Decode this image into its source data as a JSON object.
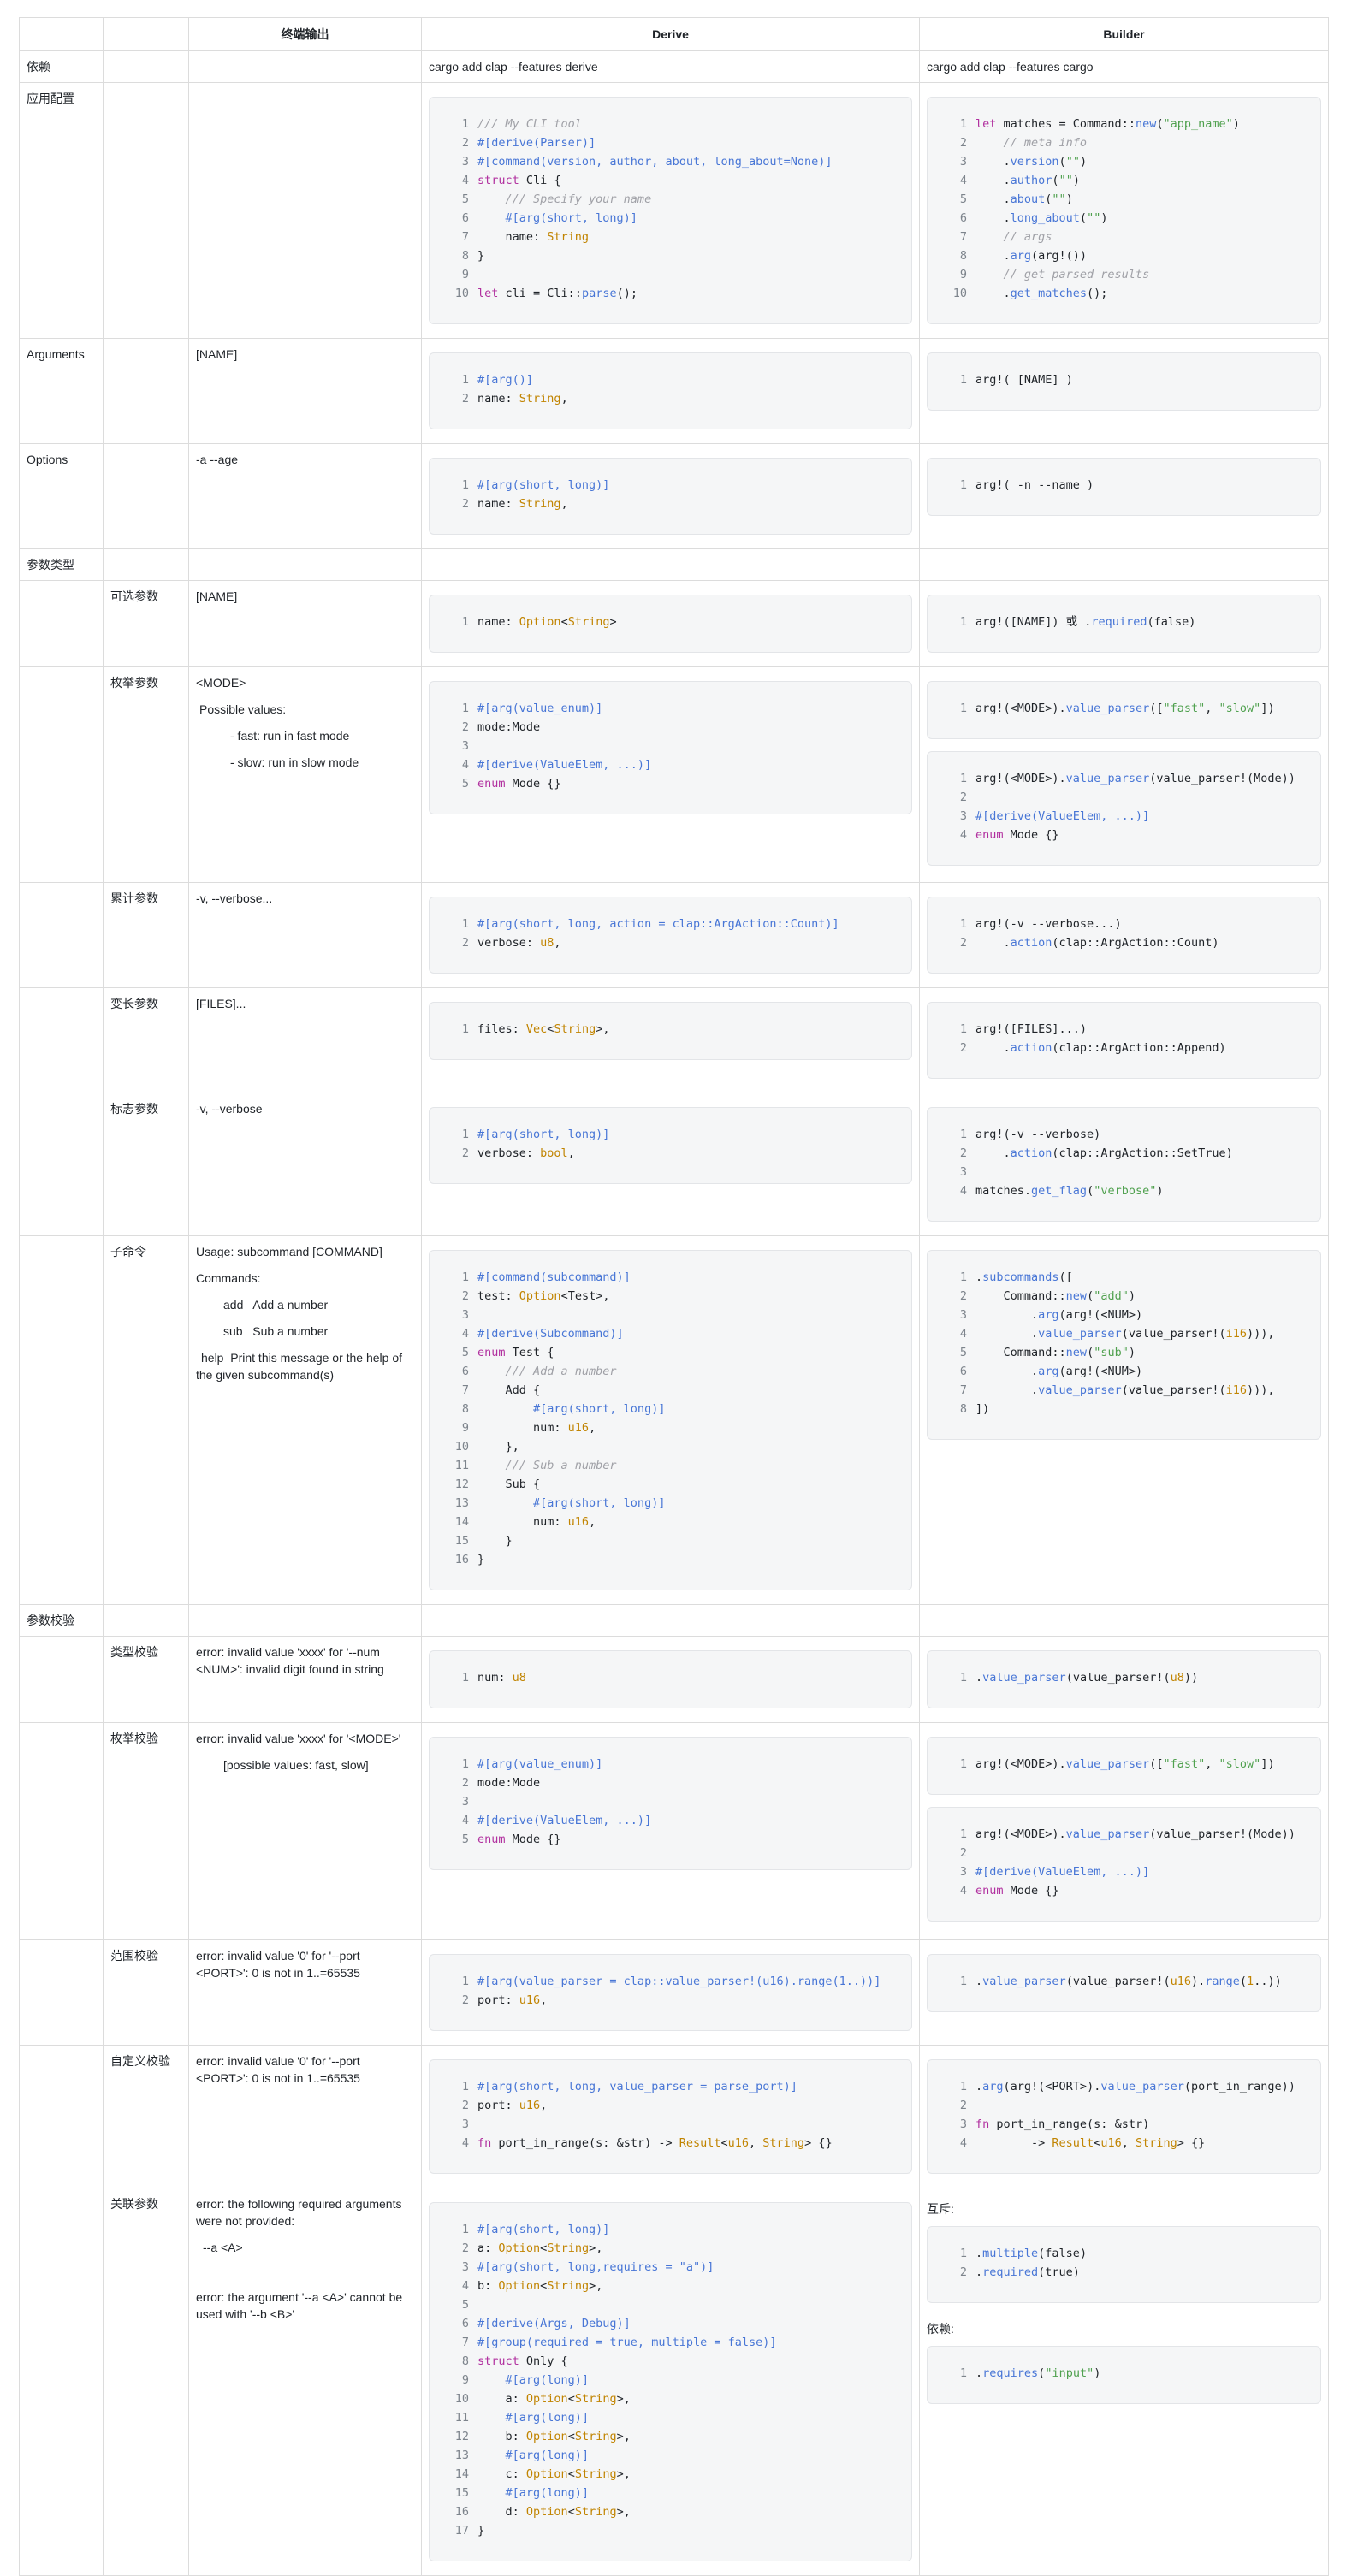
{
  "header": {
    "col1": "",
    "col2": "",
    "col3": "终端输出",
    "col4": "Derive",
    "col5": "Builder"
  },
  "rows": {
    "dep": {
      "cat": "依赖",
      "derive": "cargo add clap --features derive",
      "builder": "cargo add clap --features cargo"
    },
    "appconfig": {
      "cat": "应用配置"
    },
    "arguments": {
      "cat": "Arguments",
      "out": "[NAME]"
    },
    "options": {
      "cat": "Options",
      "out": "-a --age"
    },
    "argtypes": {
      "cat": "参数类型"
    },
    "optional": {
      "sub": "可选参数",
      "out": "[NAME]"
    },
    "enum": {
      "sub": "枚举参数",
      "out": [
        "<MODE>",
        "Possible values:",
        "- fast: run in fast mode",
        "- slow: run in slow mode"
      ]
    },
    "count": {
      "sub": "累计参数",
      "out": "-v, --verbose..."
    },
    "varargs": {
      "sub": "变长参数",
      "out": "[FILES]..."
    },
    "flag": {
      "sub": "标志参数",
      "out": "-v, --verbose"
    },
    "subcmd": {
      "sub": "子命令",
      "out": [
        "Usage: subcommand [COMMAND]",
        "Commands:",
        "add   Add a number",
        "sub   Sub a number",
        "help  Print this message or the help of the given subcommand(s)"
      ]
    },
    "validation": {
      "cat": "参数校验"
    },
    "typecheck": {
      "sub": "类型校验",
      "out": "error: invalid value 'xxxx' for '--num <NUM>': invalid digit found in string"
    },
    "enumcheck": {
      "sub": "枚举校验",
      "out": [
        "error: invalid value 'xxxx' for '<MODE>'",
        "[possible values: fast, slow]"
      ]
    },
    "rangecheck": {
      "sub": "范围校验",
      "out": "error: invalid value '0' for '--port <PORT>': 0 is not in 1..=65535"
    },
    "customcheck": {
      "sub": "自定义校验",
      "out": "error: invalid value '0' for '--port <PORT>': 0 is not in 1..=65535"
    },
    "relation": {
      "sub": "关联参数",
      "out": [
        "error: the following required arguments were not provided:",
        "--a <A>",
        "error: the argument '--a <A>' cannot be used with '--b <B>'"
      ],
      "mutex": "互斥:",
      "depends": "依赖:"
    }
  },
  "code": {
    "app_derive": [
      "/// My CLI tool",
      "#[derive(Parser)]",
      "#[command(version, author, about, long_about=None)]",
      "struct Cli {",
      "    /// Specify your name",
      "    #[arg(short, long)]",
      "    name: String",
      "}",
      "",
      "let cli = Cli::parse();"
    ],
    "app_builder": [
      "let matches = Command::new(\"app_name\")",
      "    // meta info",
      "    .version(\"\")",
      "    .author(\"\")",
      "    .about(\"\")",
      "    .long_about(\"\")",
      "    // args",
      "    .arg(arg!())",
      "    // get parsed results",
      "    .get_matches();"
    ],
    "args_derive": [
      "#[arg()]",
      "name: String,"
    ],
    "args_builder": [
      "arg!( [NAME] )"
    ],
    "opts_derive": [
      "#[arg(short, long)]",
      "name: String,"
    ],
    "opts_builder": [
      "arg!( -n --name )"
    ],
    "optional_derive": [
      "name: Option<String>"
    ],
    "optional_builder": [
      "arg!([NAME]) 或 .required(false)"
    ],
    "enum_derive": [
      "#[arg(value_enum)]",
      "mode:Mode",
      "",
      "#[derive(ValueElem, ...)]",
      "enum Mode {}"
    ],
    "enum_builder1": [
      "arg!(<MODE>).value_parser([\"fast\", \"slow\"])"
    ],
    "enum_builder2": [
      "arg!(<MODE>).value_parser(value_parser!(Mode))",
      "",
      "#[derive(ValueElem, ...)]",
      "enum Mode {}"
    ],
    "count_derive": [
      "#[arg(short, long, action = clap::ArgAction::Count)]",
      "verbose: u8,"
    ],
    "count_builder": [
      "arg!(-v --verbose...)",
      "    .action(clap::ArgAction::Count)"
    ],
    "var_derive": [
      "files: Vec<String>,"
    ],
    "var_builder": [
      "arg!([FILES]...)",
      "    .action(clap::ArgAction::Append)"
    ],
    "flag_derive": [
      "#[arg(short, long)]",
      "verbose: bool,"
    ],
    "flag_builder": [
      "arg!(-v --verbose)",
      "    .action(clap::ArgAction::SetTrue)",
      "",
      "matches.get_flag(\"verbose\")"
    ],
    "sub_derive": [
      "#[command(subcommand)]",
      "test: Option<Test>,",
      "",
      "#[derive(Subcommand)]",
      "enum Test {",
      "    /// Add a number",
      "    Add {",
      "        #[arg(short, long)]",
      "        num: u16,",
      "    },",
      "    /// Sub a number",
      "    Sub {",
      "        #[arg(short, long)]",
      "        num: u16,",
      "    }",
      "}"
    ],
    "sub_builder": [
      ".subcommands([",
      "    Command::new(\"add\")",
      "        .arg(arg!(<NUM>)",
      "        .value_parser(value_parser!(i16))),",
      "    Command::new(\"sub\")",
      "        .arg(arg!(<NUM>)",
      "        .value_parser(value_parser!(i16))),",
      "])"
    ],
    "type_derive": [
      "num: u8"
    ],
    "type_builder": [
      ".value_parser(value_parser!(u8))"
    ],
    "enumv_derive": [
      "#[arg(value_enum)]",
      "mode:Mode",
      "",
      "#[derive(ValueElem, ...)]",
      "enum Mode {}"
    ],
    "enumv_builder1": [
      "arg!(<MODE>).value_parser([\"fast\", \"slow\"])"
    ],
    "enumv_builder2": [
      "arg!(<MODE>).value_parser(value_parser!(Mode))",
      "",
      "#[derive(ValueElem, ...)]",
      "enum Mode {}"
    ],
    "range_derive": [
      "#[arg(value_parser = clap::value_parser!(u16).range(1..))]",
      "port: u16,"
    ],
    "range_builder": [
      ".value_parser(value_parser!(u16).range(1..))"
    ],
    "custom_derive": [
      "#[arg(short, long, value_parser = parse_port)]",
      "port: u16,",
      "",
      "fn port_in_range(s: &str) -> Result<u16, String> {}"
    ],
    "custom_builder": [
      ".arg(arg!(<PORT>).value_parser(port_in_range))",
      "",
      "fn port_in_range(s: &str)",
      "        -> Result<u16, String> {}"
    ],
    "rel_derive": [
      "#[arg(short, long)]",
      "a: Option<String>,",
      "#[arg(short, long,requires = \"a\")]",
      "b: Option<String>,",
      "",
      "#[derive(Args, Debug)]",
      "#[group(required = true, multiple = false)]",
      "struct Only {",
      "    #[arg(long)]",
      "    a: Option<String>,",
      "    #[arg(long)]",
      "    b: Option<String>,",
      "    #[arg(long)]",
      "    c: Option<String>,",
      "    #[arg(long)]",
      "    d: Option<String>,",
      "}"
    ],
    "rel_builder1": [
      ".multiple(false)",
      ".required(true)"
    ],
    "rel_builder2": [
      ".requires(\"input\")"
    ]
  }
}
